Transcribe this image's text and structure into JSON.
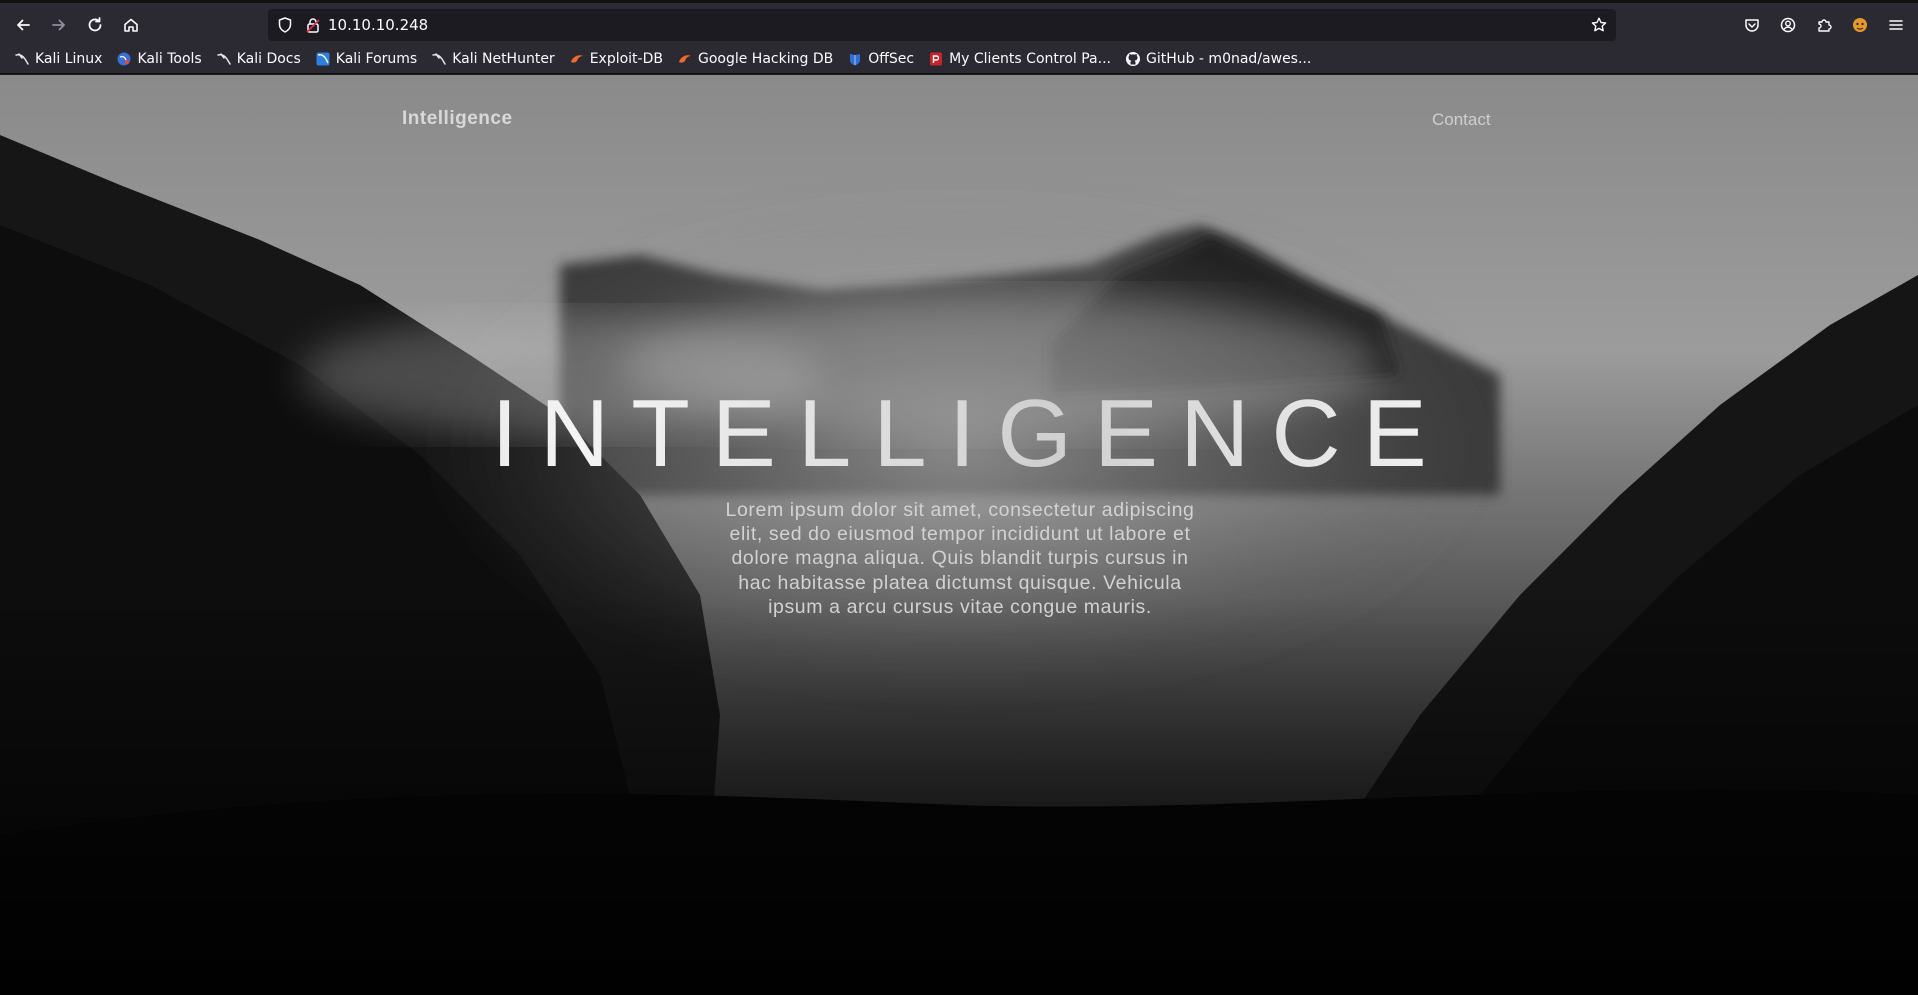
{
  "browser": {
    "url": "10.10.10.248",
    "bookmarks": [
      {
        "label": "Kali Linux",
        "icon": "kali-dragon-icon"
      },
      {
        "label": "Kali Tools",
        "icon": "kali-tools-icon"
      },
      {
        "label": "Kali Docs",
        "icon": "kali-dragon-icon"
      },
      {
        "label": "Kali Forums",
        "icon": "kali-forums-icon"
      },
      {
        "label": "Kali NetHunter",
        "icon": "kali-dragon-icon"
      },
      {
        "label": "Exploit-DB",
        "icon": "exploit-db-icon"
      },
      {
        "label": "Google Hacking DB",
        "icon": "exploit-db-icon"
      },
      {
        "label": "OffSec",
        "icon": "offsec-icon"
      },
      {
        "label": "My Clients Control Pa...",
        "icon": "control-panel-icon"
      },
      {
        "label": "GitHub - m0nad/awes...",
        "icon": "github-icon"
      }
    ]
  },
  "site": {
    "brand": "Intelligence",
    "nav_contact": "Contact",
    "hero_title": "INTELLIGENCE",
    "hero_text": "Lorem ipsum dolor sit amet, consectetur adipiscing elit, sed do eiusmod tempor incididunt ut labore et dolore magna aliqua. Quis blandit turpis cursus in hac habitasse platea dictumst quisque. Vehicula ipsum a arcu cursus vitae congue mauris."
  },
  "colors": {
    "chrome_bg": "#2b2a33",
    "urlbar_bg": "#1c1b22",
    "chrome_text": "#fbfbfe"
  }
}
